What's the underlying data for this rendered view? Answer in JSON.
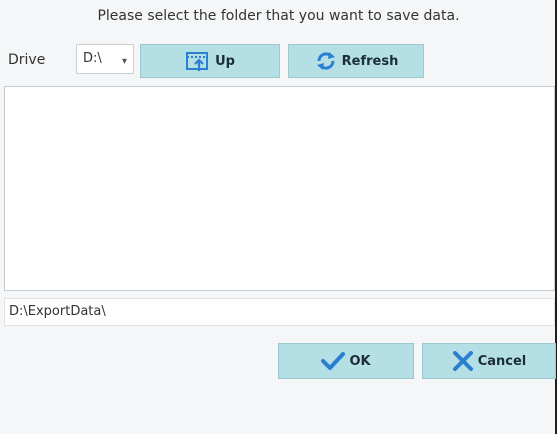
{
  "dialog": {
    "title": "Please select the folder that you want to save data."
  },
  "drive": {
    "label": "Drive",
    "selected": "D:\\",
    "caret": "⌄"
  },
  "toolbar": {
    "up_label": "Up",
    "refresh_label": "Refresh"
  },
  "path": {
    "value": "D:\\ExportData\\"
  },
  "actions": {
    "ok_label": "OK",
    "cancel_label": "Cancel"
  },
  "colors": {
    "button_bg": "#b4dfe4",
    "icon_blue": "#2a7fd1",
    "ok_check": "#2a7fd1",
    "cancel_x": "#2a7fd1"
  }
}
